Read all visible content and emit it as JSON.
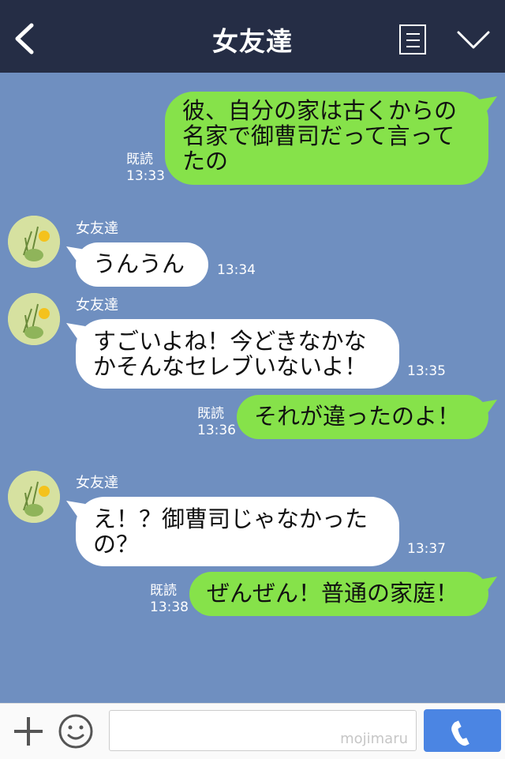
{
  "header": {
    "title": "女友達",
    "back_icon": "chevron-left-icon",
    "menu_icon": "notes-icon",
    "more_icon": "chevron-down-icon"
  },
  "messages": [
    {
      "side": "me",
      "text": "彼、自分の家は古くからの名家で御曹司だって言ってたの",
      "lines": [
        "彼、自分の家は古くからの",
        "名家で御曹司だって言って",
        "たの"
      ],
      "read": "既読",
      "time": "13:33"
    },
    {
      "side": "friend",
      "name": "女友達",
      "lines": [
        "うんうん"
      ],
      "time": "13:34"
    },
    {
      "side": "friend",
      "name": "女友達",
      "lines": [
        "すごいよね！今どきなかな",
        "かそんなセレブいないよ！"
      ],
      "time": "13:35"
    },
    {
      "side": "me",
      "lines": [
        "それが違ったのよ！"
      ],
      "read": "既読",
      "time": "13:36"
    },
    {
      "side": "friend",
      "name": "女友達",
      "lines": [
        "え！？御曹司じゃなかった",
        "の？"
      ],
      "time": "13:37"
    },
    {
      "side": "me",
      "lines": [
        "ぜんぜん！普通の家庭！"
      ],
      "read": "既読",
      "time": "13:38"
    }
  ],
  "footer": {
    "add_icon": "plus-icon",
    "sticker_icon": "smiley-icon",
    "input_placeholder": "",
    "watermark": "mojimaru",
    "call_icon": "phone-icon"
  },
  "colors": {
    "header": "#252d45",
    "background": "#6f8fc0",
    "my_bubble": "#86e24a",
    "friend_bubble": "#ffffff",
    "call_button": "#4b85e3"
  }
}
